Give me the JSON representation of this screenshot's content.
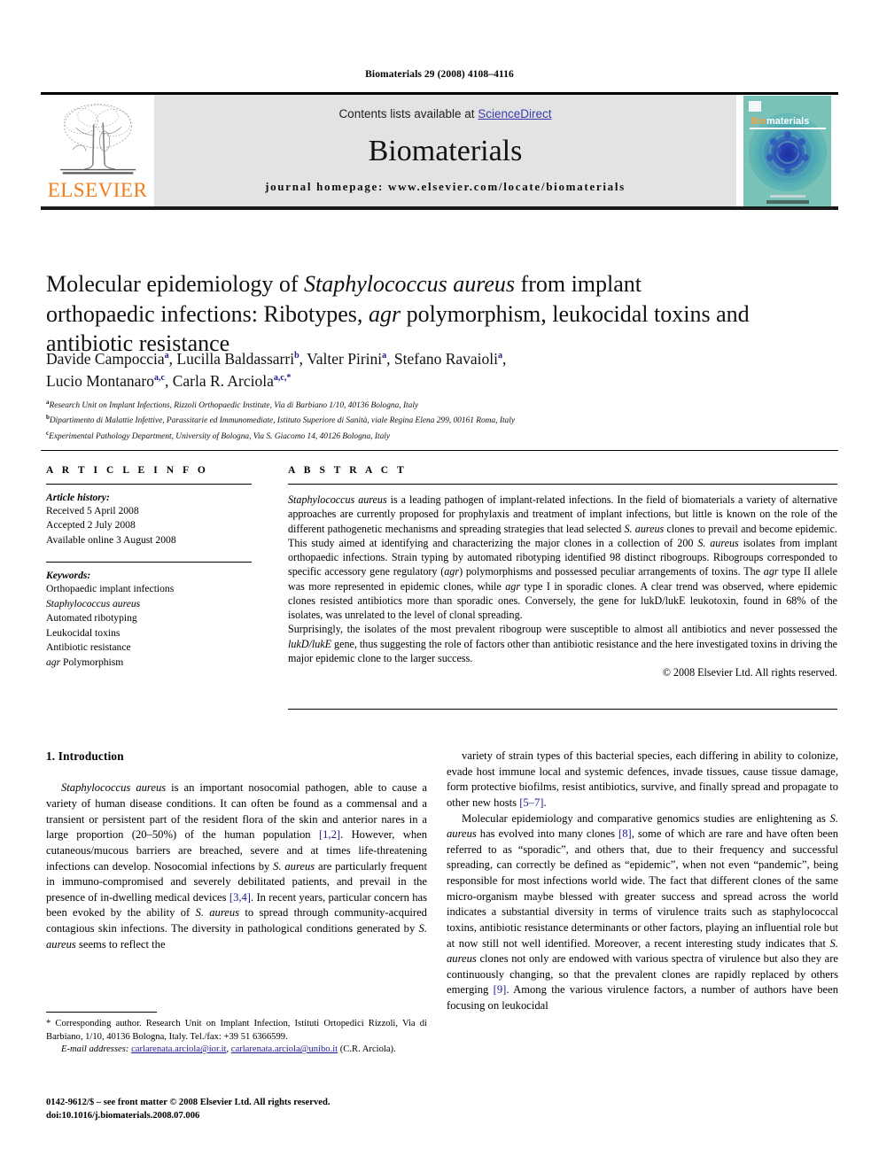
{
  "running_head": "Biomaterials 29 (2008) 4108–4116",
  "masthead": {
    "contents_prefix": "Contents lists available at ",
    "sciencedirect": "ScienceDirect",
    "journal_name": "Biomaterials",
    "homepage": "journal homepage: www.elsevier.com/locate/biomaterials",
    "publisher_wordmark": "ELSEVIER",
    "cover_title": "Biomaterials"
  },
  "article": {
    "title_line1_a": "Molecular epidemiology of ",
    "title_line1_i": "Staphylococcus aureus",
    "title_line1_b": " from implant",
    "title_line2_a": "orthopaedic infections: Ribotypes, ",
    "title_line2_i": "agr",
    "title_line2_b": " polymorphism, leukocidal",
    "title_line3": "toxins and antibiotic resistance",
    "authors": [
      {
        "name": "Davide Campoccia",
        "sup": "a"
      },
      {
        "name": "Lucilla Baldassarri",
        "sup": "b"
      },
      {
        "name": "Valter Pirini",
        "sup": "a"
      },
      {
        "name": "Stefano Ravaioli",
        "sup": "a"
      },
      {
        "name": "Lucio Montanaro",
        "sup": "a,c"
      },
      {
        "name": "Carla R. Arciola",
        "sup": "a,c,*"
      }
    ],
    "affiliations": [
      {
        "mark": "a",
        "text": "Research Unit on Implant Infections, Rizzoli Orthopaedic Institute, Via di Barbiano 1/10, 40136 Bologna, Italy"
      },
      {
        "mark": "b",
        "text": "Dipartimento di Malattie Infettive, Parassitarie ed Immunomediate, Istituto Superiore di Sanità, viale Regina Elena 299, 00161 Roma, Italy"
      },
      {
        "mark": "c",
        "text": "Experimental Pathology Department, University of Bologna, Via S. Giacomo 14, 40126 Bologna, Italy"
      }
    ]
  },
  "article_info": {
    "heading": "A R T I C L E   I N F O",
    "history_label": "Article history:",
    "history": [
      "Received 5 April 2008",
      "Accepted 2 July 2008",
      "Available online 3 August 2008"
    ],
    "keywords_label": "Keywords:",
    "keywords": [
      "Orthopaedic implant infections",
      "Staphylococcus aureus",
      "Automated ribotyping",
      "Leukocidal toxins",
      "Antibiotic resistance",
      "agr Polymorphism"
    ]
  },
  "abstract": {
    "heading": "A B S T R A C T",
    "para1_html": "<i>Staphylococcus aureus</i> is a leading pathogen of implant-related infections. In the field of biomaterials a variety of alternative approaches are currently proposed for prophylaxis and treatment of implant infections, but little is known on the role of the different pathogenetic mechanisms and spreading strategies that lead selected <i>S. aureus</i> clones to prevail and become epidemic. This study aimed at identifying and characterizing the major clones in a collection of 200 <i>S. aureus</i> isolates from implant orthopaedic infections. Strain typing by automated ribotyping identified 98 distinct ribogroups. Ribogroups corresponded to specific accessory gene regulatory (<i>agr</i>) polymorphisms and possessed peculiar arrangements of toxins. The <i>agr</i> type II allele was more represented in epidemic clones, while <i>agr</i> type I in sporadic clones. A clear trend was observed, where epidemic clones resisted antibiotics more than sporadic ones. Conversely, the gene for lukD/lukE leukotoxin, found in 68% of the isolates, was unrelated to the level of clonal spreading.",
    "para2_html": "Surprisingly, the isolates of the most prevalent ribogroup were susceptible to almost all antibiotics and never possessed the <i>lukD/lukE</i> gene, thus suggesting the role of factors other than antibiotic resistance and the here investigated toxins in driving the major epidemic clone to the larger success.",
    "copyright": "© 2008 Elsevier Ltd. All rights reserved."
  },
  "body": {
    "section_number_title": "1. Introduction",
    "left_para1_html": "<i>Staphylococcus aureus</i> is an important nosocomial pathogen, able to cause a variety of human disease conditions. It can often be found as a commensal and a transient or persistent part of the resident flora of the skin and anterior nares in a large proportion (20–50%) of the human population <span class=\"ref\">[1,2]</span>. However, when cutaneous/mucous barriers are breached, severe and at times life-threatening infections can develop. Nosocomial infections by <i>S. aureus</i> are particularly frequent in immuno-compromised and severely debilitated patients, and prevail in the presence of in-dwelling medical devices <span class=\"ref\">[3,4]</span>. In recent years, particular concern has been evoked by the ability of <i>S. aureus</i> to spread through community-acquired contagious skin infections. The diversity in pathological conditions generated by <i>S. aureus</i> seems to reflect the",
    "right_para1_html": "variety of strain types of this bacterial species, each differing in ability to colonize, evade host immune local and systemic defences, invade tissues, cause tissue damage, form protective biofilms, resist antibiotics, survive, and finally spread and propagate to other new hosts <span class=\"ref\">[5–7]</span>.",
    "right_para2_html": "Molecular epidemiology and comparative genomics studies are enlightening as <i>S. aureus</i> has evolved into many clones <span class=\"ref\">[8]</span>, some of which are rare and have often been referred to as “sporadic”, and others that, due to their frequency and successful spreading, can correctly be defined as “epidemic”, when not even “pandemic”, being responsible for most infections world wide. The fact that different clones of the same micro-organism maybe blessed with greater success and spread across the world indicates a substantial diversity in terms of virulence traits such as staphylococcal toxins, antibiotic resistance determinants or other factors, playing an influential role but at now still not well identified. Moreover, a recent interesting study indicates that <i>S. aureus</i> clones not only are endowed with various spectra of virulence but also they are continuously changing, so that the prevalent clones are rapidly replaced by others emerging <span class=\"ref\">[9]</span>. Among the various virulence factors, a number of authors have been focusing on leukocidal"
  },
  "footnote": {
    "corresponding_html": "* Corresponding author. Research Unit on Implant Infection, Istituti Ortopedici Rizzoli, Via di Barbiano, 1/10, 40136 Bologna, Italy. Tel./fax: +39 51 6366599.",
    "email_label": "E-mail addresses:",
    "email1": "carlarenata.arciola@ior.it",
    "email2": "carlarenata.arciola@unibo.it",
    "email_owner": "(C.R. Arciola)."
  },
  "imprint": {
    "line1": "0142-9612/$ – see front matter © 2008 Elsevier Ltd. All rights reserved.",
    "line2": "doi:10.1016/j.biomaterials.2008.07.006"
  },
  "colors": {
    "elsevier_orange": "#f07d1a",
    "link_blue": "#3a3ab0",
    "ref_blue": "#1b1b8f",
    "masthead_grey": "#e3e3e3"
  }
}
